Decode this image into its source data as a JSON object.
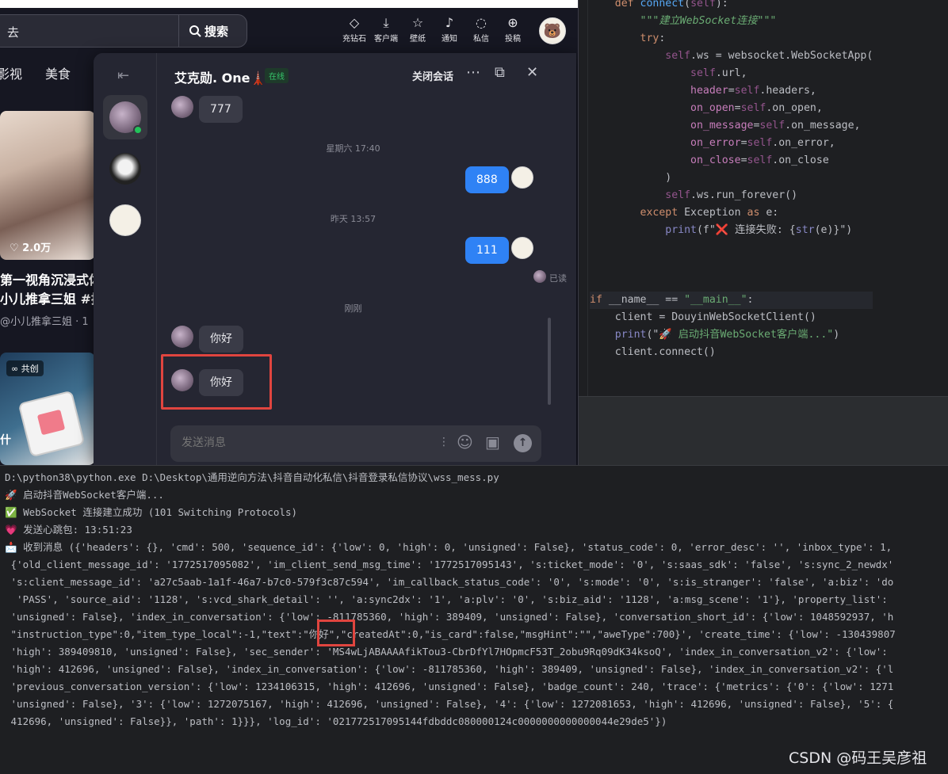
{
  "ide": {
    "code_lines": [
      {
        "segs": [
          [
            "    ",
            ""
          ],
          [
            "def ",
            "kw"
          ],
          [
            "connect",
            "fn"
          ],
          [
            "(",
            ""
          ],
          [
            "self",
            "sf"
          ],
          [
            "):",
            ""
          ]
        ]
      },
      {
        "segs": [
          [
            "        ",
            ""
          ],
          [
            "\"\"\"建立WebSocket连接\"\"\"",
            "st it"
          ]
        ]
      },
      {
        "segs": [
          [
            "        ",
            ""
          ],
          [
            "try",
            "kw"
          ],
          [
            ":",
            ""
          ]
        ]
      },
      {
        "segs": [
          [
            "            ",
            ""
          ],
          [
            "self",
            "sf"
          ],
          [
            ".ws = websocket.WebSocketApp(",
            ""
          ]
        ]
      },
      {
        "segs": [
          [
            "                ",
            ""
          ],
          [
            "self",
            "sf"
          ],
          [
            ".url,",
            ""
          ]
        ]
      },
      {
        "segs": [
          [
            "                ",
            ""
          ],
          [
            "header",
            "pa"
          ],
          [
            "=",
            ""
          ],
          [
            "self",
            "sf"
          ],
          [
            ".headers,",
            ""
          ]
        ]
      },
      {
        "segs": [
          [
            "                ",
            ""
          ],
          [
            "on_open",
            "pa"
          ],
          [
            "=",
            ""
          ],
          [
            "self",
            "sf"
          ],
          [
            ".on_open,",
            ""
          ]
        ]
      },
      {
        "segs": [
          [
            "                ",
            ""
          ],
          [
            "on_message",
            "pa"
          ],
          [
            "=",
            ""
          ],
          [
            "self",
            "sf"
          ],
          [
            ".on_message,",
            ""
          ]
        ]
      },
      {
        "segs": [
          [
            "                ",
            ""
          ],
          [
            "on_error",
            "pa"
          ],
          [
            "=",
            ""
          ],
          [
            "self",
            "sf"
          ],
          [
            ".on_error,",
            ""
          ]
        ]
      },
      {
        "segs": [
          [
            "                ",
            ""
          ],
          [
            "on_close",
            "pa"
          ],
          [
            "=",
            ""
          ],
          [
            "self",
            "sf"
          ],
          [
            ".on_close",
            ""
          ]
        ]
      },
      {
        "segs": [
          [
            "            )",
            ""
          ]
        ]
      },
      {
        "segs": [
          [
            "            ",
            ""
          ],
          [
            "self",
            "sf"
          ],
          [
            ".ws.run_forever()",
            ""
          ]
        ]
      },
      {
        "segs": [
          [
            "        ",
            ""
          ],
          [
            "except ",
            "kw"
          ],
          [
            "Exception ",
            ""
          ],
          [
            "as ",
            "kw"
          ],
          [
            "e:",
            ""
          ]
        ]
      },
      {
        "segs": [
          [
            "            ",
            ""
          ],
          [
            "print",
            "bi"
          ],
          [
            "(f\"",
            ""
          ],
          [
            "❌",
            "rk"
          ],
          [
            " 连接失败: {",
            ""
          ],
          [
            "str",
            "bi"
          ],
          [
            "(e)}\")",
            ""
          ]
        ]
      },
      {
        "segs": [
          [
            "",
            ""
          ]
        ]
      },
      {
        "segs": [
          [
            "",
            ""
          ]
        ]
      },
      {
        "segs": [
          [
            "",
            ""
          ]
        ]
      },
      {
        "segs": [
          [
            "if ",
            "kw"
          ],
          [
            "__name__ == ",
            ""
          ],
          [
            "\"__main__\"",
            "st"
          ],
          [
            ":",
            ""
          ]
        ],
        "hl": true
      },
      {
        "segs": [
          [
            "    client = DouyinWebSocketClient()",
            ""
          ]
        ]
      },
      {
        "segs": [
          [
            "    ",
            ""
          ],
          [
            "print",
            "bi"
          ],
          [
            "(\"",
            ""
          ],
          [
            "🚀 启动抖音WebSocket客户端...\"",
            "st"
          ],
          [
            ")",
            ""
          ]
        ]
      },
      {
        "segs": [
          [
            "    client.connect()",
            ""
          ]
        ]
      }
    ]
  },
  "browser": {
    "search": {
      "query": "去",
      "button_label": "搜索"
    },
    "topnav": [
      {
        "label": "充钻石",
        "icon": "◇"
      },
      {
        "label": "客户端",
        "icon": "⤓"
      },
      {
        "label": "壁纸",
        "icon": "☆"
      },
      {
        "label": "通知",
        "icon": "♪"
      },
      {
        "label": "私信",
        "icon": "◌"
      },
      {
        "label": "投稿",
        "icon": "⊕"
      }
    ],
    "categories": [
      "影视",
      "美食"
    ],
    "feed": {
      "card1_likes": "♡ 2.0万",
      "card1_title": "第一视角沉浸式体\n小儿推拿三姐 #推拿",
      "card1_author": "@小儿推拿三姐 · 1",
      "card2_badge": "∞ 共创",
      "card2_caption": "什"
    }
  },
  "chat": {
    "contact_name": "艾克勋. One🗼",
    "online_label": "在线",
    "close_session": "关闭会话",
    "messages": [
      {
        "side": "left",
        "text": "777"
      },
      {
        "time": "星期六 17:40"
      },
      {
        "side": "right",
        "text": "888"
      },
      {
        "time": "昨天 13:57"
      },
      {
        "side": "right",
        "text": "111"
      },
      {
        "time": "刚刚"
      },
      {
        "side": "left",
        "text": "你好"
      },
      {
        "side": "left",
        "text": "你好"
      }
    ],
    "read_label": "已读",
    "input_placeholder": "发送消息"
  },
  "console": {
    "lines": [
      {
        "text": "D:\\python38\\python.exe D:\\Desktop\\通用逆向方法\\抖音自动化私信\\抖音登录私信协议\\wss_mess.py"
      },
      {
        "icon": "🚀",
        "icon_class": "rk",
        "text": " 启动抖音WebSocket客户端..."
      },
      {
        "icon": "✅",
        "icon_class": "ok",
        "text": " WebSocket 连接建立成功 (101 Switching Protocols)"
      },
      {
        "icon": "💗",
        "icon_class": "heart",
        "text": " 发送心跳包: 13:51:23"
      },
      {
        "icon": "📩",
        "icon_class": "mb",
        "text": " 收到消息 ({'headers': {}, 'cmd': 500, 'sequence_id': {'low': 0, 'high': 0, 'unsigned': False}, 'status_code': 0, 'error_desc': '', 'inbox_type': 1,"
      },
      {
        "text": " {'old_client_message_id': '1772517095082', 'im_client_send_msg_time': '1772517095143', 's:ticket_mode': '0', 's:saas_sdk': 'false', 's:sync_2_newdx'"
      },
      {
        "text": " 's:client_message_id': 'a27c5aab-1a1f-46a7-b7c0-579f3c87c594', 'im_callback_status_code': '0', 's:mode': '0', 's:is_stranger': 'false', 'a:biz': 'do"
      },
      {
        "text": "  'PASS', 'source_aid': '1128', 's:vcd_shark_detail': '', 'a:sync2dx': '1', 'a:plv': '0', 's:biz_aid': '1128', 'a:msg_scene': '1'}, 'property_list':"
      },
      {
        "text": " 'unsigned': False}, 'index_in_conversation': {'low': -811785360, 'high': 389409, 'unsigned': False}, 'conversation_short_id': {'low': 1048592937, 'h"
      },
      {
        "text": " \"instruction_type\":0,\"item_type_local\":-1,\"text\":\"你好\",\"createdAt\":0,\"is_card\":false,\"msgHint\":\"\",\"aweType\":700}', 'create_time': {'low': -130439807"
      },
      {
        "text": " 'high': 389409810, 'unsigned': False}, 'sec_sender': 'MS4wLjABAAAAfikTou3-CbrDfYl7HOpmcF53T_2obu9Rq09dK34ksoQ', 'index_in_conversation_v2': {'low':"
      },
      {
        "text": " 'high': 412696, 'unsigned': False}, 'index_in_conversation': {'low': -811785360, 'high': 389409, 'unsigned': False}, 'index_in_conversation_v2': {'l"
      },
      {
        "text": " 'previous_conversation_version': {'low': 1234106315, 'high': 412696, 'unsigned': False}, 'badge_count': 240, 'trace': {'metrics': {'0': {'low': 1271"
      },
      {
        "text": " 'unsigned': False}, '3': {'low': 1272075167, 'high': 412696, 'unsigned': False}, '4': {'low': 1272081653, 'high': 412696, 'unsigned': False}, '5': {"
      },
      {
        "text": " 412696, 'unsigned': False}}, 'path': 1}}}, 'log_id': '021772517095144fdbddc080000124c0000000000000044e29de5'})"
      }
    ]
  },
  "watermark": "CSDN @码王吴彦祖"
}
